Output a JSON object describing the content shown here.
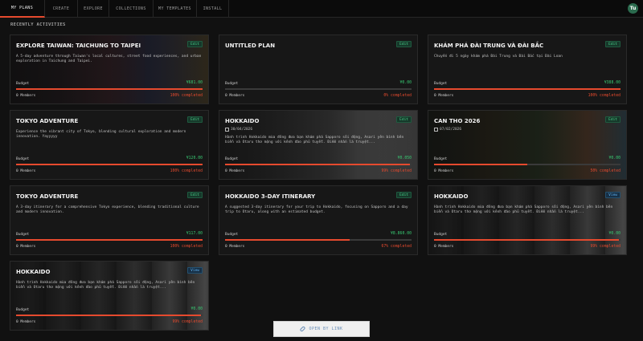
{
  "nav": {
    "tabs": [
      {
        "label": "MY PLANS",
        "active": true
      },
      {
        "label": "CREATE",
        "active": false
      },
      {
        "label": "EXPLORE",
        "active": false
      },
      {
        "label": "COLLECTIONS",
        "active": false
      },
      {
        "label": "MY TEMPLATES",
        "active": false
      },
      {
        "label": "INSTALL",
        "active": false
      }
    ],
    "avatar_initials": "Tu"
  },
  "section_title": "RECENTLY ACTIVITIES",
  "cards": [
    {
      "title": "EXPLORE TAIWAN: TAICHUNG TO TAIPEI",
      "tag": "Edit",
      "date": "",
      "description": "A 5-day adventure through Taiwan's local cultures, street food experiences, and urban exploration in Taichung and Taipei.",
      "budget_label": "Budget",
      "budget_value": "¥681.00",
      "members": "0 Members",
      "completed": "100% completed",
      "progress": 1.0,
      "photo": "city-street"
    },
    {
      "title": "UNTITLED PLAN",
      "tag": "Edit",
      "date": "",
      "description": "",
      "budget_label": "Budget",
      "budget_value": "¥0.00",
      "members": "0 Members",
      "completed": "0% completed",
      "progress": 0.0,
      "photo": ""
    },
    {
      "title": "KHÁM PHÁ ĐÀI TRUNG VÀ ĐÀI BẮC",
      "tag": "Edit",
      "date": "",
      "description": "Chuyến đi 5 ngày khám phá Đài Trung và Đài Bắc tại Đài Loan",
      "budget_label": "Budget",
      "budget_value": "¥388.00",
      "members": "0 Members",
      "completed": "100% completed",
      "progress": 1.0,
      "photo": ""
    },
    {
      "title": "TOKYO ADVENTURE",
      "tag": "Edit",
      "date": "",
      "description": "Experience the vibrant city of Tokyo, blending cultural exploration and modern innovation. Yayyyyy",
      "budget_label": "Budget",
      "budget_value": "¥120.00",
      "members": "0 Members",
      "completed": "100% completed",
      "progress": 1.0,
      "photo": ""
    },
    {
      "title": "HOKKAIDO",
      "tag": "Edit",
      "date": "30/04/2026",
      "description": "Hành trình Hokkaido mùa đông đưa bạn khám phá Sapporo sôi động, Asari yên bình bên biển và Otaru thơ mộng với kênh đào phủ tuyết. Điểm nhấn là truyệt...",
      "budget_label": "Budget",
      "budget_value": "¥0.050",
      "members": "0 Members",
      "completed": "99% completed",
      "progress": 0.99,
      "photo": "snow-street"
    },
    {
      "title": "CAN THO 2026",
      "tag": "Edit",
      "date": "07/02/2026",
      "description": "",
      "budget_label": "Budget",
      "budget_value": "¥0.00",
      "members": "0 Members",
      "completed": "50% completed",
      "progress": 0.5,
      "photo": "market"
    },
    {
      "title": "TOKYO ADVENTURE",
      "tag": "Edit",
      "date": "",
      "description": "A 3-day itinerary for a comprehensive Tokyo experience, blending traditional culture and modern innovation.",
      "budget_label": "Budget",
      "budget_value": "¥117.00",
      "members": "0 Members",
      "completed": "100% completed",
      "progress": 1.0,
      "photo": ""
    },
    {
      "title": "HOKKAIDO 3-DAY ITINERARY",
      "tag": "Edit",
      "date": "",
      "description": "A suggested 3-day itinerary for your trip to Hokkaido, focusing on Sapporo and a day trip to Otaru, along with an estimated budget.",
      "budget_label": "Budget",
      "budget_value": "¥8.860.00",
      "members": "0 Members",
      "completed": "67% completed",
      "progress": 0.67,
      "photo": ""
    },
    {
      "title": "HOKKAIDO",
      "tag": "View",
      "date": "",
      "description": "Hành trình Hokkaido mùa đông đưa bạn khám phá Sapporo sôi động, Asari yên bình bên biển và Otaru thơ mộng với kênh đào phủ tuyết. Điểm nhấn là truyệt...",
      "budget_label": "Budget",
      "budget_value": "¥0.00",
      "members": "0 Members",
      "completed": "99% completed",
      "progress": 0.99,
      "photo": "lanterns"
    },
    {
      "title": "HOKKAIDO",
      "tag": "View",
      "date": "",
      "description": "Hành trình Hokkaido mùa đông đưa bạn khám phá Sapporo sôi động, Asari yên bình bên biển và Otaru thơ mộng với kênh đào phủ tuyết. Điểm nhấn là truyệt...",
      "budget_label": "Budget",
      "budget_value": "¥0.00",
      "members": "0 Members",
      "completed": "99% completed",
      "progress": 0.99,
      "photo": "lanterns"
    }
  ],
  "open_link": {
    "label": "OPEN BY LINK",
    "icon": "link-icon"
  },
  "colors": {
    "accent": "#e64a2e",
    "budget": "#38c872",
    "edit_tag": "#4ad08a",
    "view_tag": "#5fb0ef"
  }
}
